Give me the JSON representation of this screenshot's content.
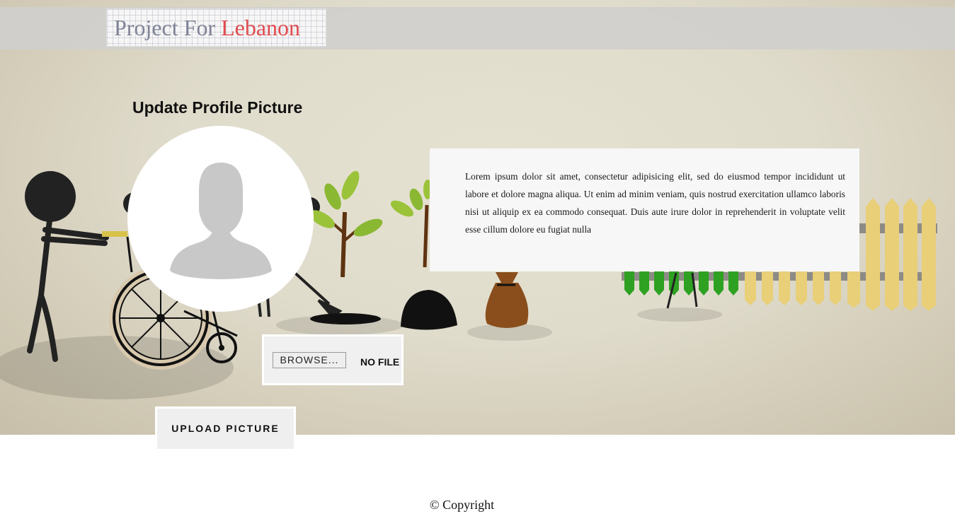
{
  "header": {
    "logo_text_1": "Project For",
    "logo_text_2": "Lebanon"
  },
  "profile": {
    "title": "Update Profile Picture",
    "avatar_icon": "user-silhouette-icon"
  },
  "info": {
    "text": "Lorem ipsum dolor sit amet, consectetur adipisicing elit, sed do eiusmod tempor incididunt ut labore et dolore magna aliqua. Ut enim ad minim veniam, quis nostrud exercitation ullamco laboris nisi ut aliquip ex ea commodo consequat. Duis aute irure dolor in reprehenderit in voluptate velit esse cillum dolore eu fugiat nulla"
  },
  "file_input": {
    "browse_label": "BROWSE...",
    "status": "NO FILE"
  },
  "upload": {
    "label": "UPLOAD PICTURE"
  },
  "footer": {
    "copyright": "© Copyright"
  },
  "colors": {
    "logo_gray": "#7f8396",
    "logo_red": "#e04a4e",
    "header_strip": "#d0cfcd",
    "panel_bg": "#f7f7f7",
    "hero_bg": "#e0dccc"
  }
}
